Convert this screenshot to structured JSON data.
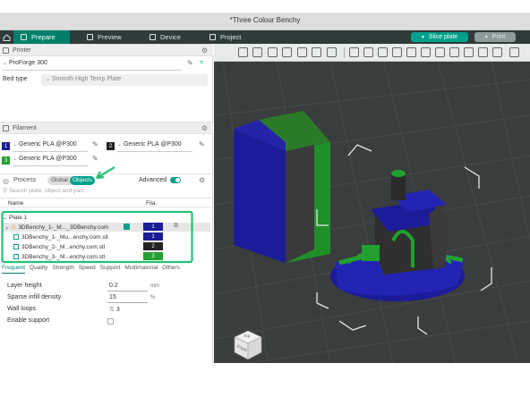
{
  "window": {
    "title": "*Three Colour Benchy"
  },
  "tabs": [
    {
      "label": "Prepare"
    },
    {
      "label": "Preview"
    },
    {
      "label": "Device"
    },
    {
      "label": "Project"
    }
  ],
  "actions": {
    "slice_label": "Slice plate",
    "print_label": "Print"
  },
  "printer": {
    "section_label": "Printer",
    "name": "ProForge 300",
    "bed_type_label": "Bed type",
    "bed_type_value": "Smooth High Temp Plate"
  },
  "filament": {
    "section_label": "Filament",
    "slots": [
      {
        "num": "1",
        "name": "Generic PLA @P300",
        "color": "#1c1c9a"
      },
      {
        "num": "2",
        "name": "Generic PLA @P300",
        "color": "#222222"
      },
      {
        "num": "3",
        "name": "Generic PLA @P300",
        "color": "#22a030"
      }
    ]
  },
  "process": {
    "section_label": "Process",
    "toggle_global": "Global",
    "toggle_objects": "Objects",
    "advanced_label": "Advanced",
    "search_placeholder": "Search plate, object and part.",
    "col_name": "Name",
    "col_fila": "Fila."
  },
  "tree": {
    "plate_label": "Plate 1",
    "object": {
      "name": "3DBenchy_1-_M..._3DBenchy.com",
      "fila": "1"
    },
    "parts": [
      {
        "name": "3DBenchy_1-_Mu...enchy.com.stl",
        "fila": "1",
        "color": "#1c1c9a"
      },
      {
        "name": "3DBenchy_2-_M...enchy.com.stl",
        "fila": "2",
        "color": "#222222"
      },
      {
        "name": "3DBenchy_3-_M...enchy.com.stl",
        "fila": "3",
        "color": "#22a030"
      }
    ]
  },
  "param_tabs": [
    "Frequent",
    "Quality",
    "Strength",
    "Speed",
    "Support",
    "Multimaterial",
    "Others"
  ],
  "params": [
    {
      "label": "Layer height",
      "value": "0.2",
      "unit": "mm"
    },
    {
      "label": "Sparse infill density",
      "value": "15",
      "unit": "%"
    },
    {
      "label": "Wall loops",
      "value": "3",
      "unit": ""
    },
    {
      "label": "Enable support",
      "value": "",
      "unit": ""
    }
  ],
  "nav_cube": {
    "top": "Top",
    "front": "Front"
  },
  "annotation_color": "#22c274"
}
